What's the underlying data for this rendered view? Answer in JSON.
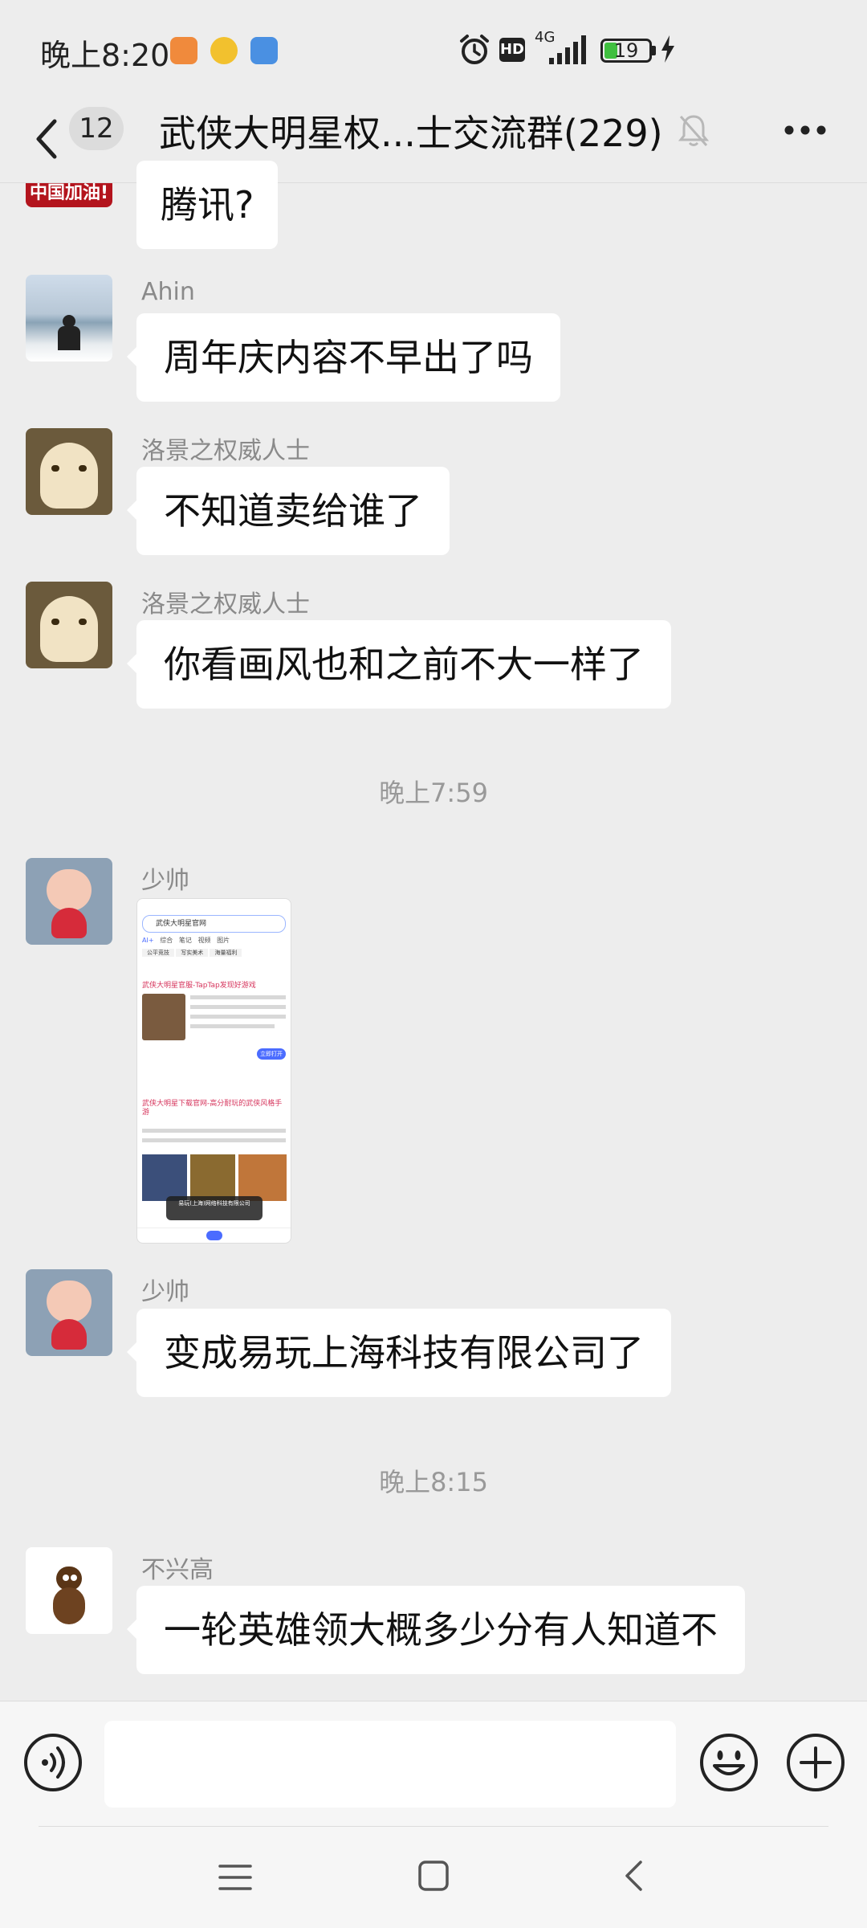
{
  "status_bar": {
    "time": "晚上8:20",
    "network": "4G",
    "hd": "HD",
    "battery": "19"
  },
  "header": {
    "unread_count": "12",
    "title": "武侠大明星权...士交流群(229)"
  },
  "messages": [
    {
      "text": "腾讯?"
    },
    {
      "sender": "Ahin",
      "text": "周年庆内容不早出了吗"
    },
    {
      "sender": "洛景之权威人士",
      "text": "不知道卖给谁了"
    },
    {
      "sender": "洛景之权威人士",
      "text": "你看画风也和之前不大一样了"
    },
    {
      "timestamp": "晚上7:59"
    },
    {
      "sender": "少帅",
      "type": "image"
    },
    {
      "sender": "少帅",
      "text": "变成易玩上海科技有限公司了"
    },
    {
      "timestamp": "晚上8:15"
    },
    {
      "sender": "不兴高",
      "text": "一轮英雄领大概多少分有人知道不"
    }
  ],
  "shared_image": {
    "search": "武侠大明星官网",
    "tabs": [
      "AI+",
      "综合",
      "笔记",
      "视频",
      "图片"
    ],
    "chips": [
      "公平竞技",
      "写实美术",
      "海量福利"
    ],
    "result1_title": "武侠大明星官服-TapTap发现好游戏",
    "result2_title": "武侠大明星下载官网-高分耐玩的武侠风格手游",
    "toast": "易玩(上海)网络科技有限公司",
    "button": "立即打开"
  },
  "input": {
    "placeholder": ""
  },
  "icons": {
    "back": "chevron-left-icon",
    "mute": "bell-off-icon",
    "more": "more-dots-icon",
    "voice": "voice-icon",
    "emoji": "emoji-icon",
    "plus": "plus-icon",
    "nav_menu": "menu-icon",
    "nav_home": "home-icon",
    "nav_back": "nav-back-icon"
  },
  "colors": {
    "background": "#ededed",
    "bubble": "#ffffff",
    "meta_text": "#8a8a8a",
    "battery": "#3fbf3f"
  }
}
